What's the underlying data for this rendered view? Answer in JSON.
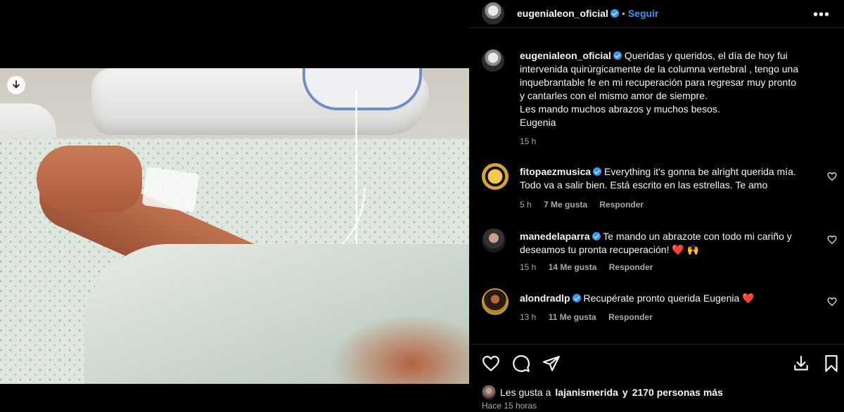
{
  "post": {
    "author": "eugenialeon_oficial",
    "follow_label": "Seguir",
    "dot": "•",
    "more_label": "•••",
    "caption": {
      "author": "eugenialeon_oficial",
      "lines": [
        "Queridas y queridos, el día de hoy fui",
        "intervenida quirúrgicamente de la columna vertebral , tengo una",
        "inquebrantable fe en mi recuperación para regresar muy pronto",
        "y cantarles con el mismo amor de siempre.",
        "Les mando muchos abrazos y muchos besos.",
        "Eugenia"
      ],
      "time": "15 h"
    }
  },
  "comments": [
    {
      "author": "fitopaezmusica",
      "text": "Everything it's gonna be alright querida mía. Todo va a salir bien. Está escrito en las estrellas. Te amo",
      "time": "5 h",
      "likes": "7 Me gusta",
      "reply": "Responder"
    },
    {
      "author": "manedelaparra",
      "text": "Te mando un abrazote con todo mi cariño y deseamos tu pronta recuperación! ❤️ 🙌",
      "time": "15 h",
      "likes": "14 Me gusta",
      "reply": "Responder"
    },
    {
      "author": "alondradlp",
      "text": "Recupérate pronto querida Eugenia ❤️",
      "time": "13 h",
      "likes": "11 Me gusta",
      "reply": "Responder"
    }
  ],
  "footer": {
    "likes_prefix": "Les gusta a",
    "likes_user": "lajanismerida",
    "likes_middle": "y",
    "likes_count": "2170 personas más",
    "time": "Hace 15 horas"
  },
  "icons": {
    "download": "download-icon",
    "heart": "heart-icon",
    "comment": "comment-icon",
    "share": "share-icon",
    "save": "bookmark-icon",
    "verified": "verified-icon"
  },
  "colors": {
    "accent": "#3897f0",
    "background": "#000000",
    "muted": "#a8a8a8"
  }
}
